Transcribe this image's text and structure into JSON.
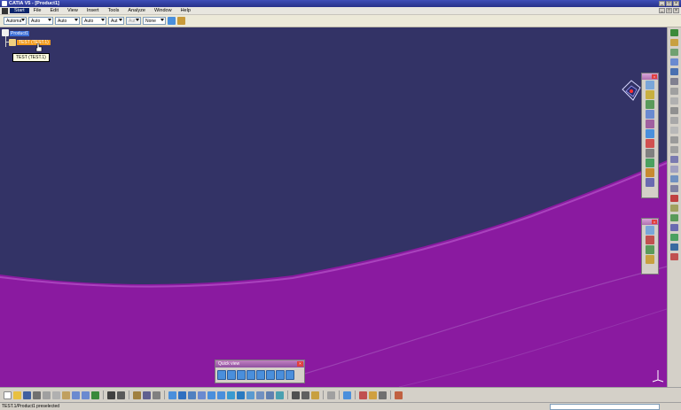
{
  "window": {
    "title": "CATIA V5 - [Product1]",
    "controls": [
      "minimize",
      "maximize",
      "close"
    ]
  },
  "menu": {
    "items": [
      "Start",
      "File",
      "Edit",
      "View",
      "Insert",
      "Tools",
      "Analyze",
      "Window",
      "Help"
    ],
    "active": "Start"
  },
  "graphic_properties": {
    "combos": [
      {
        "value": "Automa",
        "enabled": true
      },
      {
        "value": "Auto",
        "enabled": true
      },
      {
        "value": "Auto",
        "enabled": true
      },
      {
        "value": "Auto",
        "enabled": true
      },
      {
        "value": "Aut",
        "enabled": true
      },
      {
        "value": "Aut",
        "enabled": false
      },
      {
        "value": "None",
        "enabled": true
      }
    ]
  },
  "tree": {
    "root_label": "Product1",
    "child_label": "TEST (TEST.1)",
    "tooltip": "TEST (TEST.1)"
  },
  "quick_view": {
    "title": "Quick view"
  },
  "status": {
    "text": "TEST.1/Product1 preselected"
  },
  "colors": {
    "background": "#333366",
    "part_surface": "#8a1aa0",
    "part_highlight": "#a030b8",
    "tree_root_highlight": "#3c6fd8",
    "tree_child_highlight": "#f29b1e"
  },
  "icons": {
    "compass": "compass-icon",
    "axis": "xyz-axis-icon"
  }
}
